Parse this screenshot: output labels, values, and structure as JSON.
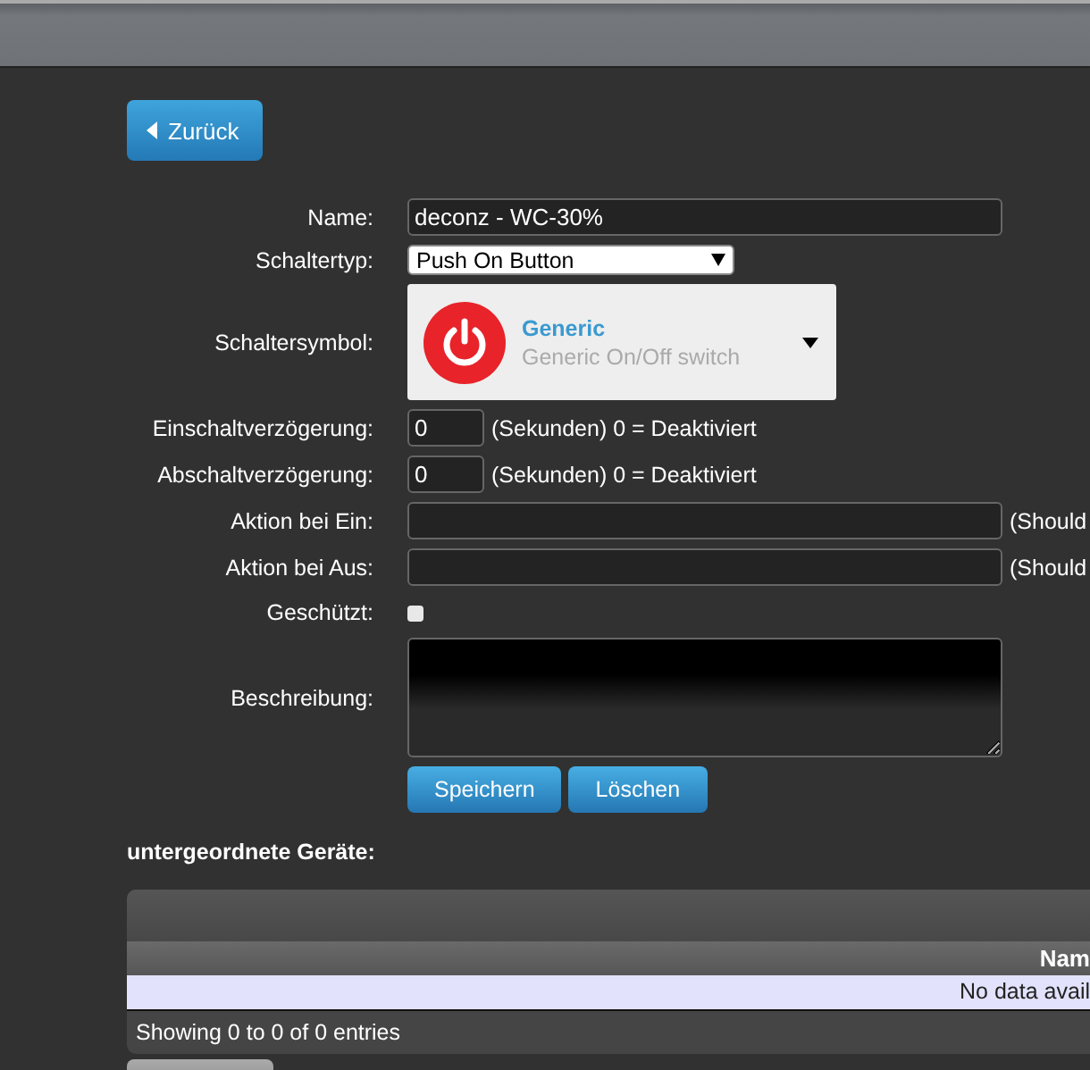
{
  "back_button": {
    "label": "Zurück"
  },
  "form": {
    "name": {
      "label": "Name:",
      "value": "deconz - WC-30%"
    },
    "switch_type": {
      "label": "Schaltertyp:",
      "value": "Push On Button"
    },
    "switch_icon": {
      "label": "Schaltersymbol:",
      "title": "Generic",
      "subtitle": "Generic On/Off switch"
    },
    "on_delay": {
      "label": "Einschaltverzögerung:",
      "value": "0",
      "hint": "(Sekunden) 0 = Deaktiviert"
    },
    "off_delay": {
      "label": "Abschaltverzögerung:",
      "value": "0",
      "hint": "(Sekunden) 0 = Deaktiviert"
    },
    "on_action": {
      "label": "Aktion bei Ein:",
      "hint": "(Should"
    },
    "off_action": {
      "label": "Aktion bei Aus:",
      "hint": "(Should"
    },
    "protected": {
      "label": "Geschützt:",
      "checked": false
    },
    "description": {
      "label": "Beschreibung:"
    },
    "buttons": [
      "Speichern",
      "Löschen"
    ]
  },
  "sub_devices": {
    "title": "untergeordnete Geräte:",
    "table": {
      "columns": [
        "Nam"
      ],
      "empty_message": "No data avail",
      "info": "Showing 0 to 0 of 0 entries"
    }
  }
}
